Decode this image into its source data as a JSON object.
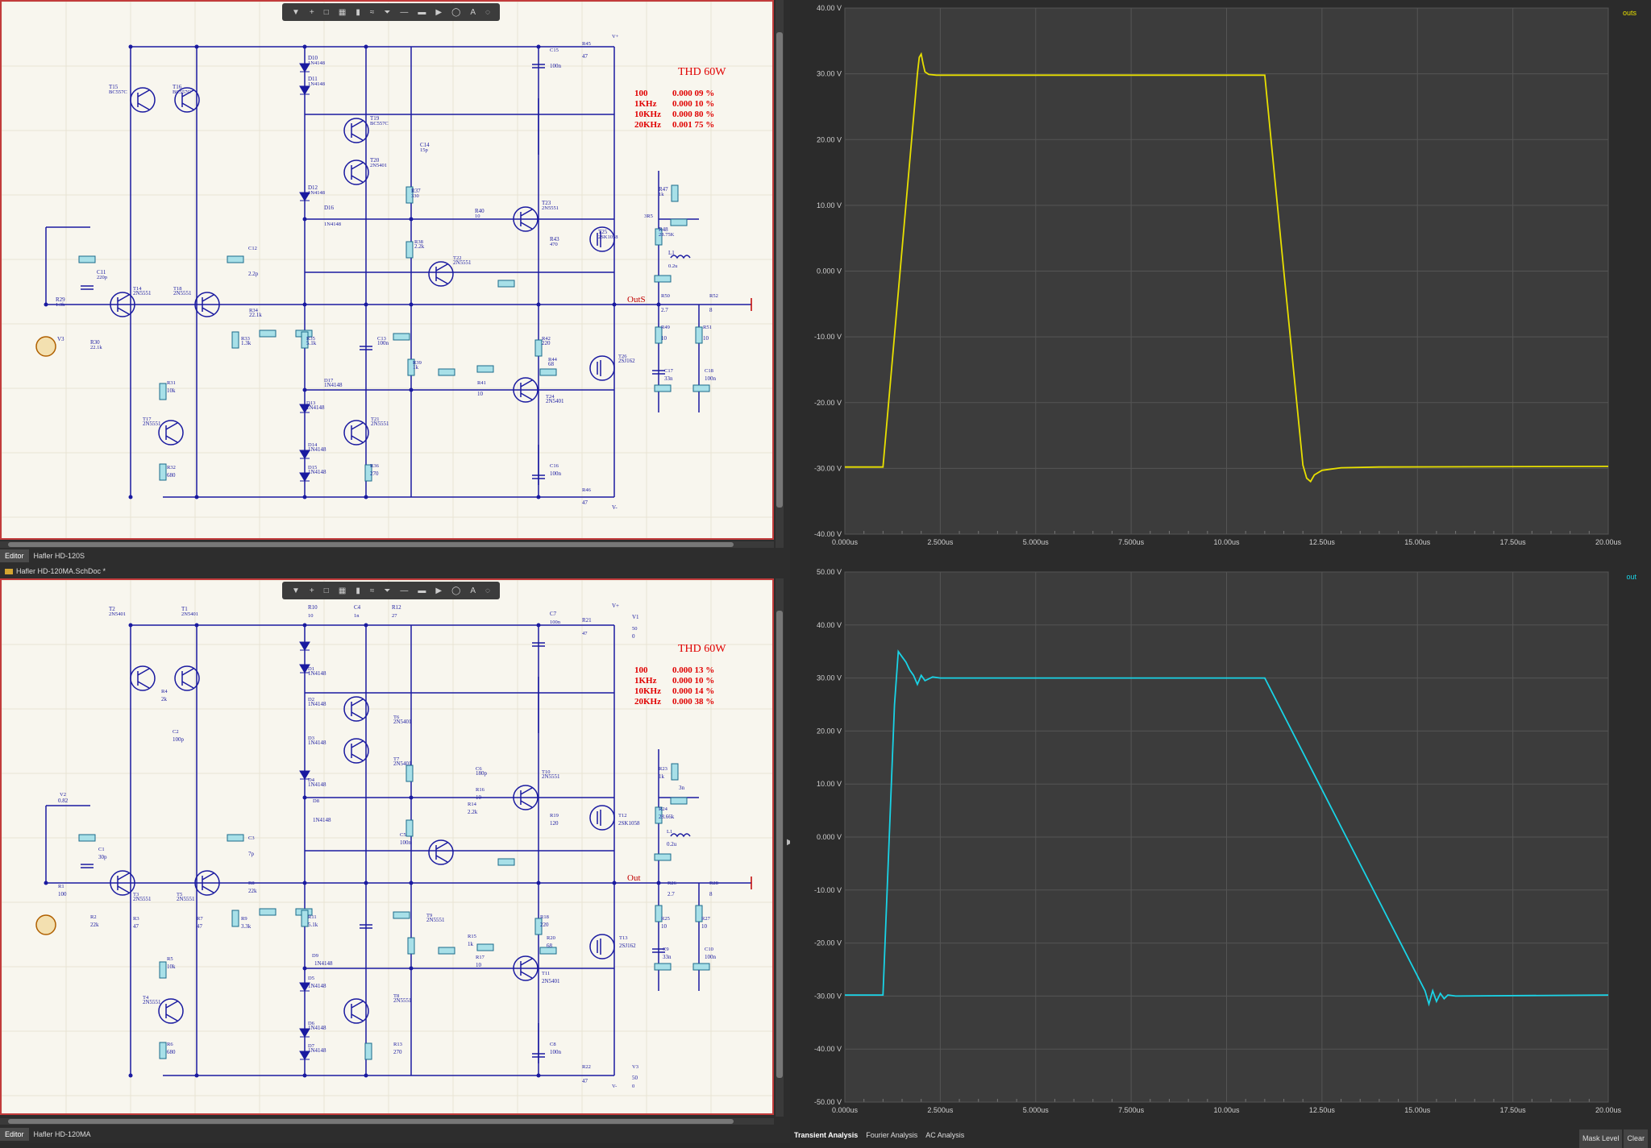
{
  "editor_top": {
    "tab_label": "Editor",
    "doc_label": "Hafler HD-120S",
    "thd_title": "THD 60W",
    "thd_rows": [
      {
        "freq": "100",
        "value": "0.000 09 %"
      },
      {
        "freq": "1KHz",
        "value": "0.000 10 %"
      },
      {
        "freq": "10KHz",
        "value": "0.000 80 %"
      },
      {
        "freq": "20KHz",
        "value": "0.001 75 %"
      }
    ],
    "out_label": "OutS",
    "labels": [
      "T15",
      "BC557C",
      "T16",
      "BC557C",
      "D10",
      "1N4148",
      "D11",
      "1N4148",
      "T19",
      "BC557C",
      "T20",
      "2N5401",
      "C14",
      "15p",
      "D12",
      "1N4148",
      "D16",
      "1N4148",
      "R37",
      "330",
      "R40",
      "10",
      "T23",
      "2N5551",
      "R43",
      "470",
      "T25",
      "2SK1058",
      "R47",
      "1k",
      "R48",
      "28.75K",
      "L1",
      "0.2u",
      "C11",
      "220p",
      "R29",
      "1.3k",
      "R30",
      "22.1k",
      "V3",
      "T14",
      "2N5551",
      "T18",
      "2N5551",
      "C12",
      "2.2p",
      "R34",
      "22.1k",
      "R33",
      "1.3k",
      "R35",
      "5.1k",
      "C13",
      "100n",
      "R38",
      "2.2k",
      "T22",
      "2N5551",
      "R39",
      "1k",
      "R42",
      "220",
      "R44",
      "68",
      "T26",
      "2SJ162",
      "R50",
      "2.7",
      "R52",
      "8",
      "R49",
      "10",
      "R51",
      "10",
      "C17",
      "33n",
      "C18",
      "100n",
      "R31",
      "10k",
      "T17",
      "2N5551",
      "D13",
      "1N4148",
      "D17",
      "1N4148",
      "R41",
      "10",
      "T24",
      "2N5401",
      "T21",
      "2N5551",
      "D14",
      "1N4148",
      "D15",
      "1N4148",
      "R36",
      "270",
      "R32",
      "680",
      "C16",
      "100n",
      "R46",
      "47",
      "R45",
      "47",
      "C15",
      "100n",
      "V+",
      "V-",
      "3R5"
    ]
  },
  "editor_bottom": {
    "tab_label": "Editor",
    "doc_label": "Hafler HD-120MA",
    "file_tab": "Hafler HD-120MA.SchDoc *",
    "thd_title": "THD 60W",
    "thd_rows": [
      {
        "freq": "100",
        "value": "0.000 13 %"
      },
      {
        "freq": "1KHz",
        "value": "0.000 10 %"
      },
      {
        "freq": "10KHz",
        "value": "0.000 14 %"
      },
      {
        "freq": "20KHz",
        "value": "0.000 38 %"
      }
    ],
    "out_label": "Out",
    "labels": [
      "T2",
      "2N5401",
      "T1",
      "2N5401",
      "R10",
      "10",
      "C4",
      "1n",
      "R12",
      "27",
      "C7",
      "100n",
      "R21",
      "47",
      "V1",
      "50",
      "0",
      "D1",
      "1N4148",
      "D2",
      "1N4148",
      "R4",
      "2k",
      "C2",
      "100p",
      "D3",
      "1N4148",
      "T6",
      "2N5401",
      "T7",
      "2N5401",
      "D4",
      "1N4148",
      "C6",
      "180p",
      "R16",
      "10",
      "T10",
      "2N5551",
      "D8",
      "1N4148",
      "R14",
      "2.2k",
      "R19",
      "120",
      "T12",
      "2SK1058",
      "R23",
      "1k",
      "R24",
      "28.66k",
      "L1",
      "0.2u",
      "V2",
      "0.82",
      "C3",
      "7p",
      "C5",
      "100n",
      "C1",
      "30p",
      "R1",
      "100",
      "T3",
      "2N5551",
      "T5",
      "2N5551",
      "R8",
      "22k",
      "R26",
      "2.7",
      "R28",
      "8",
      "R2",
      "22k",
      "R3",
      "47",
      "R7",
      "47",
      "R9",
      "3.3k",
      "R11",
      "5.1k",
      "T9",
      "2N5551",
      "R15",
      "1k",
      "R18",
      "220",
      "R20",
      "68",
      "T13",
      "2SJ162",
      "R25",
      "10",
      "R27",
      "10",
      "C9",
      "33n",
      "C10",
      "100n",
      "R5",
      "10k",
      "D9",
      "1N4148",
      "D5",
      "1N4148",
      "R17",
      "10",
      "T11",
      "2N5401",
      "T4",
      "2N5551",
      "T8",
      "2N5551",
      "D6",
      "1N4148",
      "D7",
      "1N4148",
      "R13",
      "270",
      "R6",
      "680",
      "C8",
      "100n",
      "R22",
      "47",
      "V3",
      "50",
      "0",
      "V+",
      "V-",
      "3n"
    ]
  },
  "plot_top": {
    "trace_name": "outs",
    "trace_color": "#e8e000",
    "chart_data": {
      "type": "line",
      "xlabel": "",
      "ylabel": "",
      "xlim": [
        0,
        20
      ],
      "ylim": [
        -40,
        40
      ],
      "x_ticks": [
        "0.000us",
        "2.500us",
        "5.000us",
        "7.500us",
        "10.00us",
        "12.50us",
        "15.00us",
        "17.50us",
        "20.00us"
      ],
      "y_ticks": [
        "40.00 V",
        "30.00 V",
        "20.00 V",
        "10.00 V",
        "0.000 V",
        "-10.00 V",
        "-20.00 V",
        "-30.00 V",
        "-40.00 V"
      ],
      "series": [
        {
          "name": "outs",
          "x": [
            0,
            1.0,
            1.9,
            1.95,
            2.0,
            2.05,
            2.1,
            2.2,
            2.4,
            11.0,
            11.5,
            12.0,
            12.1,
            12.2,
            12.3,
            12.5,
            13.0,
            14.0,
            20.0
          ],
          "y": [
            -29.8,
            -29.8,
            30.0,
            32.5,
            33.0,
            31.5,
            30.3,
            29.9,
            29.8,
            29.8,
            0.0,
            -29.5,
            -31.5,
            -32.0,
            -31.0,
            -30.3,
            -29.9,
            -29.8,
            -29.7
          ]
        }
      ]
    }
  },
  "plot_bottom": {
    "trace_name": "out",
    "trace_color": "#19d3e6",
    "chart_data": {
      "type": "line",
      "xlabel": "",
      "ylabel": "",
      "xlim": [
        0,
        20
      ],
      "ylim": [
        -50,
        50
      ],
      "x_ticks": [
        "0.000us",
        "2.500us",
        "5.000us",
        "7.500us",
        "10.00us",
        "12.50us",
        "15.00us",
        "17.50us",
        "20.00us"
      ],
      "y_ticks": [
        "50.00 V",
        "40.00 V",
        "30.00 V",
        "20.00 V",
        "10.00 V",
        "0.000 V",
        "-10.00 V",
        "-20.00 V",
        "-30.00 V",
        "-40.00 V",
        "-50.00 V"
      ],
      "series": [
        {
          "name": "out",
          "x": [
            0,
            1.0,
            1.3,
            1.4,
            1.5,
            1.6,
            1.7,
            1.8,
            1.9,
            2.0,
            2.1,
            2.3,
            2.5,
            11.0,
            15.2,
            15.3,
            15.4,
            15.5,
            15.6,
            15.7,
            15.8,
            16.0,
            20.0
          ],
          "y": [
            -29.8,
            -29.8,
            25.0,
            35.0,
            34.0,
            33.0,
            31.5,
            30.5,
            28.8,
            30.5,
            29.5,
            30.2,
            30.0,
            30.0,
            -29.0,
            -31.5,
            -29.0,
            -31.0,
            -29.5,
            -30.5,
            -29.8,
            -30.0,
            -29.8
          ]
        }
      ]
    }
  },
  "bottom_tabs": [
    "Transient Analysis",
    "Fourier Analysis",
    "AC Analysis"
  ],
  "bottom_buttons": [
    "Mask Level",
    "Clear"
  ]
}
